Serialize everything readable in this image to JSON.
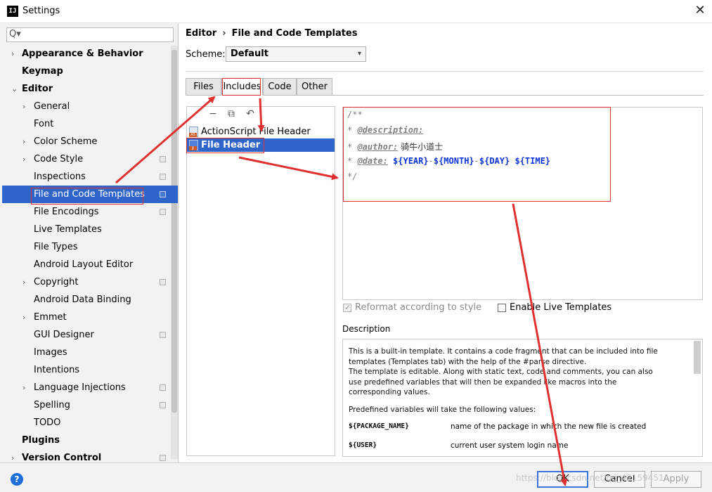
{
  "window": {
    "title": "Settings",
    "app_icon_text": "IJ",
    "close_glyph": "✕"
  },
  "search": {
    "value": "",
    "icon": "search-icon",
    "glyph": "Q▾"
  },
  "tree": [
    {
      "label": "Appearance & Behavior",
      "bold": true,
      "expandable": true,
      "expanded": false,
      "level": 0
    },
    {
      "label": "Keymap",
      "bold": true,
      "level": 0
    },
    {
      "label": "Editor",
      "bold": true,
      "expandable": true,
      "expanded": true,
      "level": 0
    },
    {
      "label": "General",
      "expandable": true,
      "level": 1
    },
    {
      "label": "Font",
      "level": 1
    },
    {
      "label": "Color Scheme",
      "expandable": true,
      "level": 1
    },
    {
      "label": "Code Style",
      "expandable": true,
      "level": 1,
      "project": true
    },
    {
      "label": "Inspections",
      "level": 1,
      "project": true
    },
    {
      "label": "File and Code Templates",
      "level": 1,
      "project": true,
      "selected": true
    },
    {
      "label": "File Encodings",
      "level": 1,
      "project": true
    },
    {
      "label": "Live Templates",
      "level": 1
    },
    {
      "label": "File Types",
      "level": 1
    },
    {
      "label": "Android Layout Editor",
      "level": 1
    },
    {
      "label": "Copyright",
      "expandable": true,
      "level": 1,
      "project": true
    },
    {
      "label": "Android Data Binding",
      "level": 1
    },
    {
      "label": "Emmet",
      "expandable": true,
      "level": 1
    },
    {
      "label": "GUI Designer",
      "level": 1,
      "project": true
    },
    {
      "label": "Images",
      "level": 1
    },
    {
      "label": "Intentions",
      "level": 1
    },
    {
      "label": "Language Injections",
      "expandable": true,
      "level": 1,
      "project": true
    },
    {
      "label": "Spelling",
      "level": 1,
      "project": true
    },
    {
      "label": "TODO",
      "level": 1
    },
    {
      "label": "Plugins",
      "bold": true,
      "level": 0
    },
    {
      "label": "Version Control",
      "bold": true,
      "expandable": true,
      "level": 0,
      "project": true
    }
  ],
  "breadcrumb": {
    "parent": "Editor",
    "separator": "›",
    "current": "File and Code Templates"
  },
  "scheme": {
    "label": "Scheme:",
    "value": "Default",
    "chevron": "▾"
  },
  "tabs": [
    {
      "label": "Files"
    },
    {
      "label": "Includes",
      "active": true
    },
    {
      "label": "Code"
    },
    {
      "label": "Other"
    }
  ],
  "toolbar": {
    "remove_glyph": "−",
    "copy_glyph": "⧉",
    "reset_glyph": "↶"
  },
  "templates": [
    {
      "label": "ActionScript File Header",
      "badge": "AS"
    },
    {
      "label": "File Header",
      "badge": "J",
      "selected": true
    }
  ],
  "editor_lines": [
    {
      "parts": [
        {
          "t": "/**",
          "c": ""
        }
      ]
    },
    {
      "parts": [
        {
          "t": "* ",
          "c": ""
        },
        {
          "t": "@description:",
          "c": "tag"
        }
      ]
    },
    {
      "parts": [
        {
          "t": "* ",
          "c": ""
        },
        {
          "t": "@author:",
          "c": "tag"
        },
        {
          "t": " 骑牛小道士",
          "c": "txt"
        }
      ]
    },
    {
      "parts": [
        {
          "t": "* ",
          "c": ""
        },
        {
          "t": "@date:",
          "c": "tag"
        },
        {
          "t": " ${YEAR}",
          "c": "var"
        },
        {
          "t": "-",
          "c": ""
        },
        {
          "t": "${MONTH}",
          "c": "var"
        },
        {
          "t": "-",
          "c": ""
        },
        {
          "t": "${DAY}",
          "c": "var"
        },
        {
          "t": " ${TIME}",
          "c": "var"
        }
      ]
    },
    {
      "parts": [
        {
          "t": "*/",
          "c": ""
        }
      ]
    }
  ],
  "options": {
    "reformat": {
      "label": "Reformat according to style",
      "checked": true,
      "disabled": true
    },
    "live_templates": {
      "label": "Enable Live Templates",
      "checked": false
    }
  },
  "description": {
    "title": "Description",
    "lines": [
      "This is a built-in template. It contains a code fragment that can be included into file",
      "templates (Templates tab) with the help of the #parse directive.",
      "The template is editable. Along with static text, code and comments, you can also",
      "use predefined variables that will then be expanded like macros into the",
      "corresponding values."
    ],
    "predefined_intro": "Predefined variables will take the following values:",
    "variables": [
      {
        "name": "${PACKAGE_NAME}",
        "desc": "name of the package in which the new file is created"
      },
      {
        "name": "${USER}",
        "desc": "current user system login name"
      }
    ]
  },
  "buttons": {
    "help": "?",
    "ok": "OK",
    "cancel": "Cancel",
    "apply": "Apply"
  },
  "watermark": "https://blog.csdn.net/qq_42159451",
  "annotation_color": "#e03030"
}
